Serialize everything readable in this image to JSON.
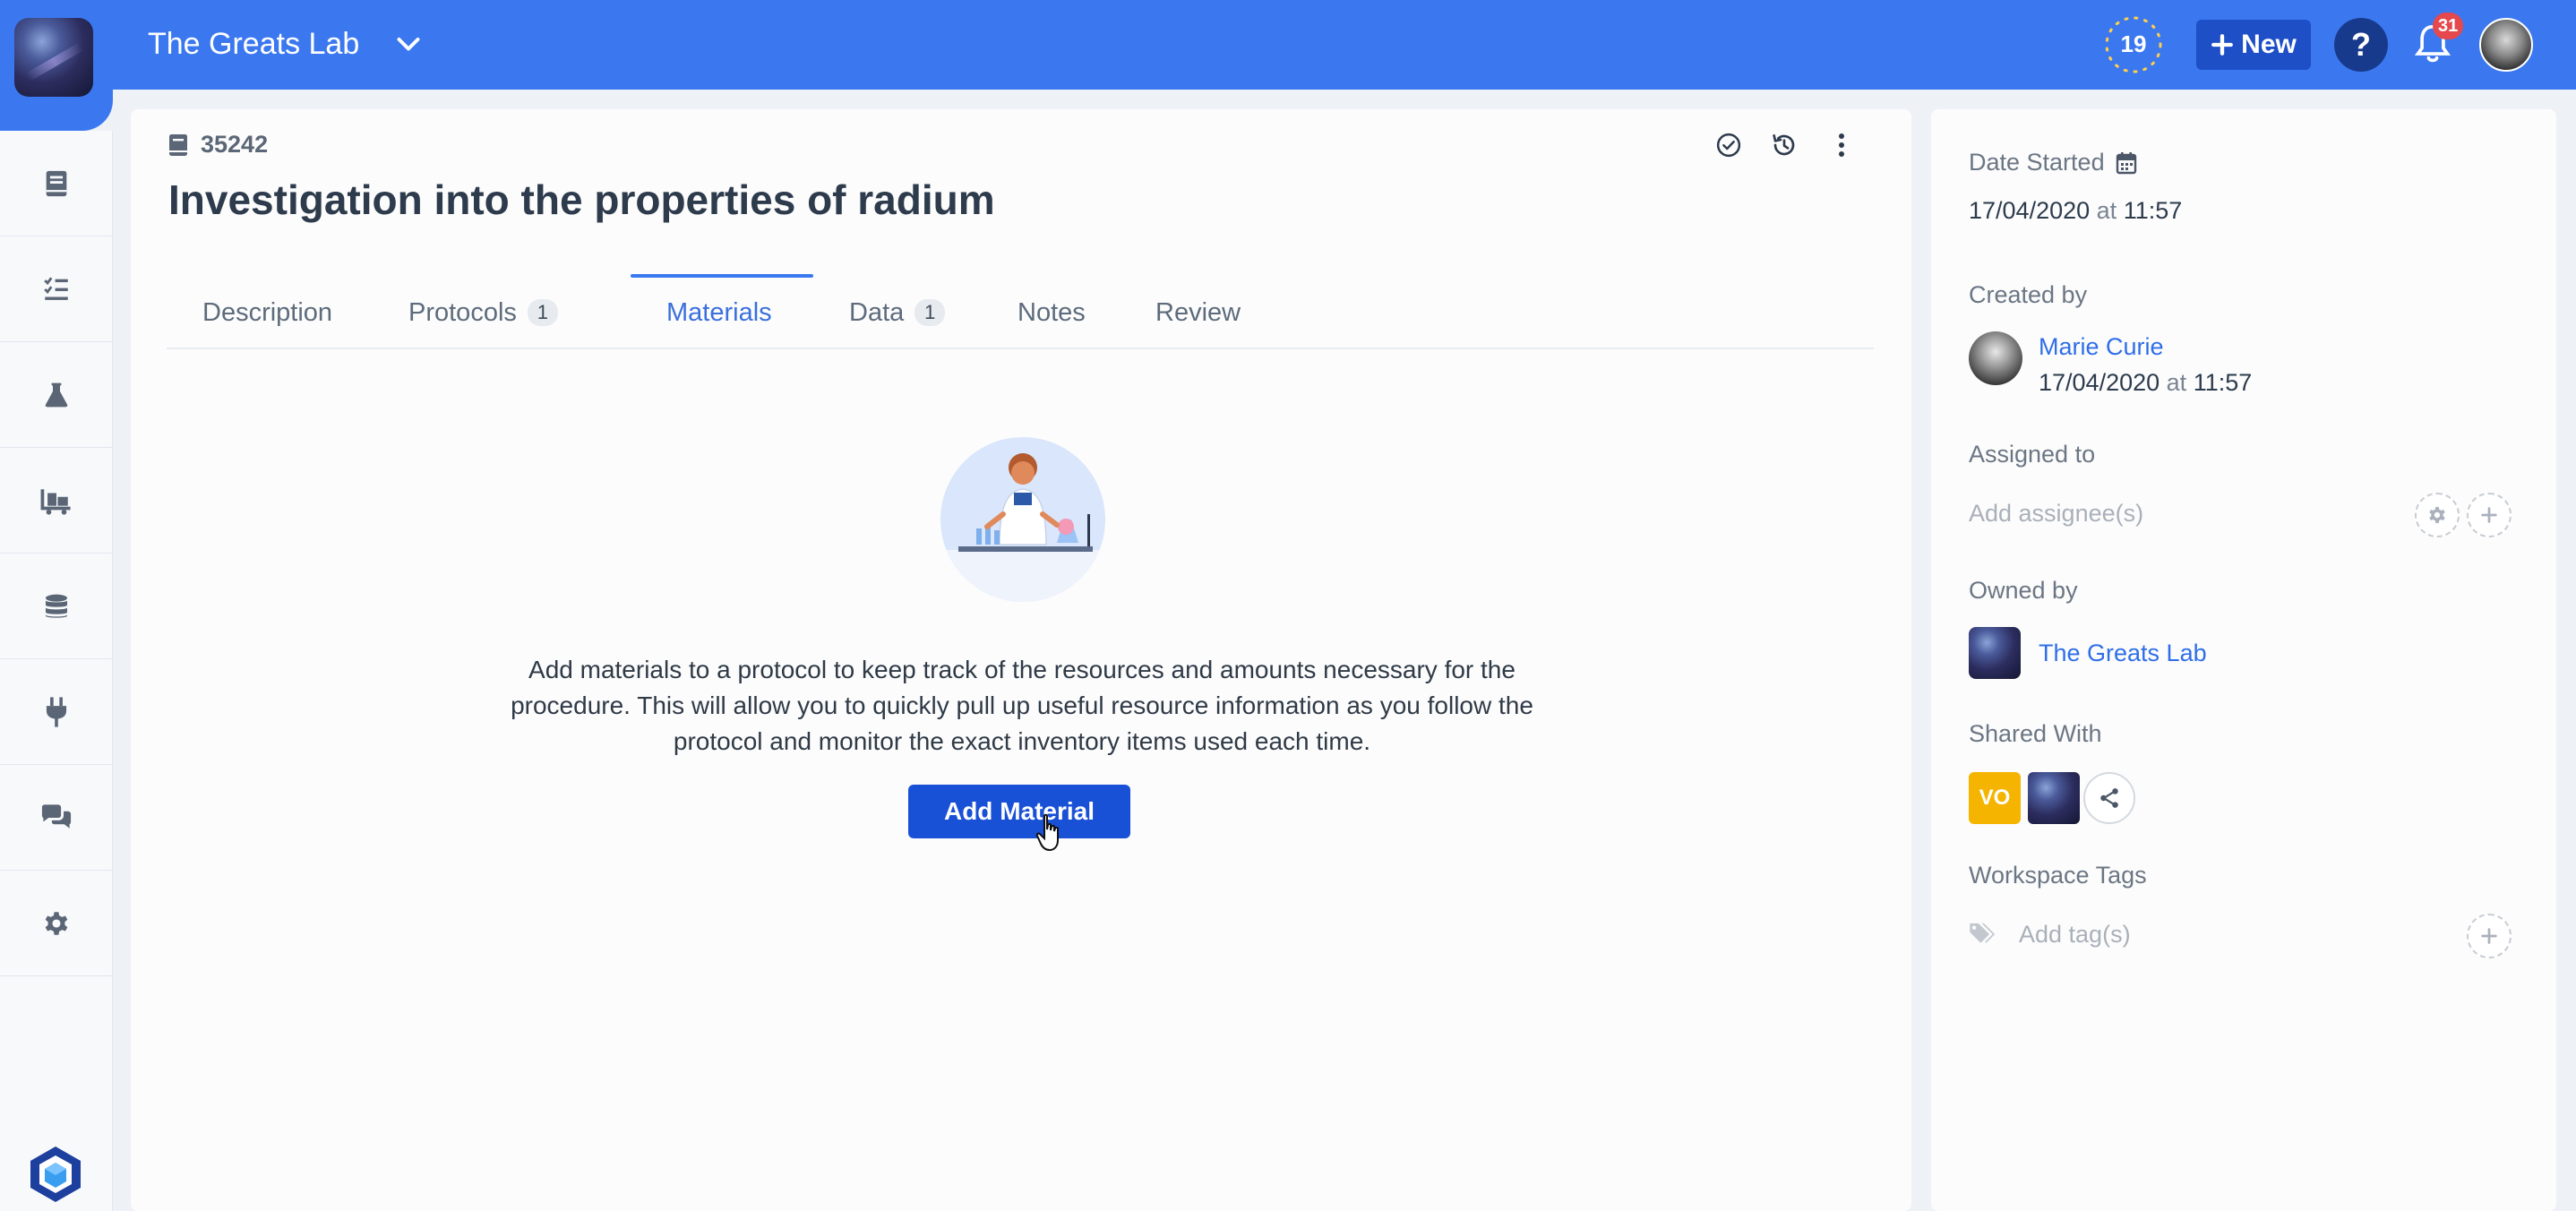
{
  "colors": {
    "topbar": "#3b78f0",
    "primary_button": "#1850d6",
    "active_tab": "#3a6fdc",
    "link": "#2f6ee8",
    "badge_red": "#e5484d",
    "shared_vo": "#f5b400"
  },
  "header": {
    "workspace_name": "The Greats Lab",
    "streak_count": "19",
    "new_button_label": "New",
    "help_label": "?",
    "notification_count": "31"
  },
  "sidebar": {
    "items": [
      {
        "icon": "notebook-icon"
      },
      {
        "icon": "checklist-icon"
      },
      {
        "icon": "flask-icon"
      },
      {
        "icon": "inventory-cart-icon"
      },
      {
        "icon": "database-icon"
      },
      {
        "icon": "plug-icon"
      },
      {
        "icon": "chat-icon"
      },
      {
        "icon": "gear-icon"
      }
    ]
  },
  "entry": {
    "id": "35242",
    "title": "Investigation into the properties of radium",
    "tabs": [
      {
        "label": "Description",
        "count": null
      },
      {
        "label": "Protocols",
        "count": "1"
      },
      {
        "label": "Materials",
        "count": null,
        "active": true
      },
      {
        "label": "Data",
        "count": "1"
      },
      {
        "label": "Notes",
        "count": null
      },
      {
        "label": "Review",
        "count": null
      }
    ],
    "empty_state": {
      "description": "Add materials to a protocol to keep track of the resources and amounts necessary for the procedure. This will allow you to quickly pull up useful resource information as you follow the protocol and monitor the exact inventory items used each time.",
      "button_label": "Add Material"
    }
  },
  "side_panel": {
    "date_started_label": "Date Started",
    "date_started_date": "17/04/2020",
    "date_started_at": "at",
    "date_started_time": "11:57",
    "created_by_label": "Created by",
    "created_by_name": "Marie Curie",
    "created_date": "17/04/2020",
    "created_at": "at",
    "created_time": "11:57",
    "assigned_to_label": "Assigned to",
    "assignee_placeholder": "Add assignee(s)",
    "owned_by_label": "Owned by",
    "owner_name": "The Greats Lab",
    "shared_with_label": "Shared With",
    "shared_initials": "VO",
    "workspace_tags_label": "Workspace Tags",
    "tags_placeholder": "Add tag(s)"
  }
}
